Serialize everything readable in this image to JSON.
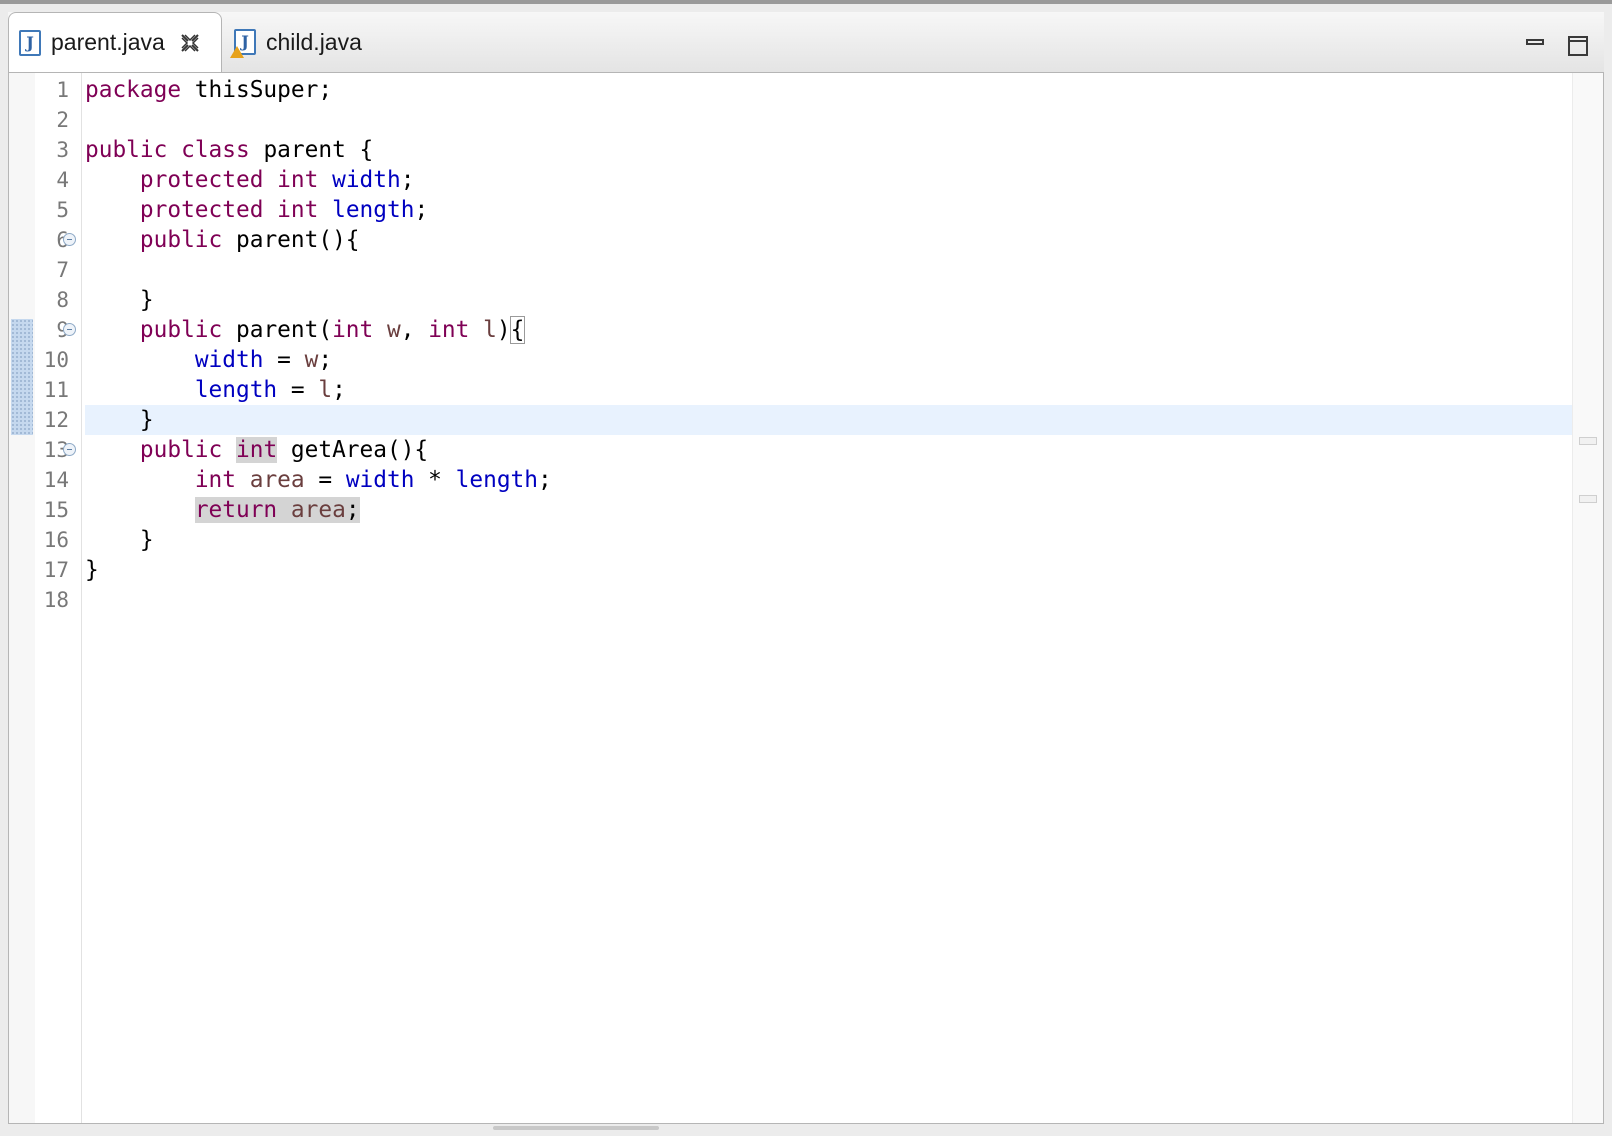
{
  "tabs": [
    {
      "label": "parent.java",
      "icon": "java-file-icon",
      "active": true,
      "closable": true
    },
    {
      "label": "child.java",
      "icon": "java-file-warning-icon",
      "active": false
    }
  ],
  "window_controls": {
    "minimize_icon": "minimize-icon",
    "maximize_icon": "maximize-icon"
  },
  "editor": {
    "current_line": 12,
    "folding_lines": [
      6,
      9,
      13
    ],
    "lines": [
      {
        "num": "1",
        "tokens": [
          {
            "t": "package",
            "c": "kw"
          },
          {
            "t": " thisSuper;"
          }
        ]
      },
      {
        "num": "2",
        "tokens": []
      },
      {
        "num": "3",
        "tokens": [
          {
            "t": "public",
            "c": "kw"
          },
          {
            "t": " "
          },
          {
            "t": "class",
            "c": "kw"
          },
          {
            "t": " parent {"
          }
        ]
      },
      {
        "num": "4",
        "tokens": [
          {
            "t": "    "
          },
          {
            "t": "protected",
            "c": "kw"
          },
          {
            "t": " "
          },
          {
            "t": "int",
            "c": "kw"
          },
          {
            "t": " "
          },
          {
            "t": "width",
            "c": "fd"
          },
          {
            "t": ";"
          }
        ]
      },
      {
        "num": "5",
        "tokens": [
          {
            "t": "    "
          },
          {
            "t": "protected",
            "c": "kw"
          },
          {
            "t": " "
          },
          {
            "t": "int",
            "c": "kw"
          },
          {
            "t": " "
          },
          {
            "t": "length",
            "c": "fd"
          },
          {
            "t": ";"
          }
        ]
      },
      {
        "num": "6",
        "tokens": [
          {
            "t": "    "
          },
          {
            "t": "public",
            "c": "kw"
          },
          {
            "t": " parent(){"
          }
        ]
      },
      {
        "num": "7",
        "tokens": []
      },
      {
        "num": "8",
        "tokens": [
          {
            "t": "    }"
          }
        ]
      },
      {
        "num": "9",
        "tokens": [
          {
            "t": "    "
          },
          {
            "t": "public",
            "c": "kw"
          },
          {
            "t": " parent("
          },
          {
            "t": "int",
            "c": "kw"
          },
          {
            "t": " "
          },
          {
            "t": "w",
            "c": "lv"
          },
          {
            "t": ", "
          },
          {
            "t": "int",
            "c": "kw"
          },
          {
            "t": " "
          },
          {
            "t": "l",
            "c": "lv"
          },
          {
            "t": ")"
          },
          {
            "t": "{",
            "c": "br"
          }
        ]
      },
      {
        "num": "10",
        "tokens": [
          {
            "t": "        "
          },
          {
            "t": "width",
            "c": "fd"
          },
          {
            "t": " = "
          },
          {
            "t": "w",
            "c": "lv"
          },
          {
            "t": ";"
          }
        ]
      },
      {
        "num": "11",
        "tokens": [
          {
            "t": "        "
          },
          {
            "t": "length",
            "c": "fd"
          },
          {
            "t": " = "
          },
          {
            "t": "l",
            "c": "lv"
          },
          {
            "t": ";"
          }
        ]
      },
      {
        "num": "12",
        "tokens": [
          {
            "t": "    }"
          }
        ]
      },
      {
        "num": "13",
        "tokens": [
          {
            "t": "    "
          },
          {
            "t": "public",
            "c": "kw"
          },
          {
            "t": " "
          },
          {
            "t": "int",
            "c": "kw hl"
          },
          {
            "t": " getArea(){"
          }
        ]
      },
      {
        "num": "14",
        "tokens": [
          {
            "t": "        "
          },
          {
            "t": "int",
            "c": "kw"
          },
          {
            "t": " "
          },
          {
            "t": "area",
            "c": "lv"
          },
          {
            "t": " = "
          },
          {
            "t": "width",
            "c": "fd"
          },
          {
            "t": " * "
          },
          {
            "t": "length",
            "c": "fd"
          },
          {
            "t": ";"
          }
        ]
      },
      {
        "num": "15",
        "tokens": [
          {
            "t": "        "
          },
          {
            "t": "return",
            "c": "kw hl"
          },
          {
            "t": " ",
            "c": "hl"
          },
          {
            "t": "area",
            "c": "lv hl"
          },
          {
            "t": ";",
            "c": "hl"
          }
        ]
      },
      {
        "num": "16",
        "tokens": [
          {
            "t": "    }"
          }
        ]
      },
      {
        "num": "17",
        "tokens": [
          {
            "t": "}"
          }
        ]
      },
      {
        "num": "18",
        "tokens": []
      }
    ]
  }
}
